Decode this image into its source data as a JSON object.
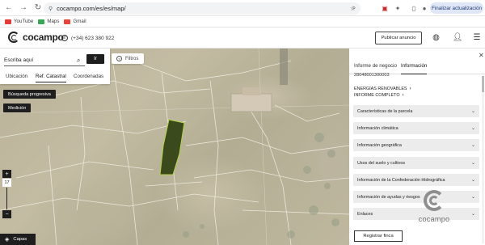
{
  "browser": {
    "url": "cocampo.com/es/es/map/",
    "update_label": "Finalizar actualización",
    "bookmarks": [
      {
        "label": "YouTube",
        "color": "#e53935"
      },
      {
        "label": "Maps",
        "color": "#34a853"
      },
      {
        "label": "Gmail",
        "color": "#ea4335"
      }
    ]
  },
  "header": {
    "logo_text": "cocampo",
    "phone": "(+34) 623 380 922",
    "publish_label": "Publicar anuncio"
  },
  "search": {
    "placeholder": "Escriba aquí",
    "go_label": "Ir",
    "tabs": [
      "Ubicación",
      "Ref. Catastral",
      "Coordenadas"
    ],
    "active_tab": "Ref. Catastral"
  },
  "map": {
    "filters_label": "Filtros",
    "progressive_search_label": "Búsqueda progresiva",
    "measure_label": "Medición",
    "zoom_in": "+",
    "zoom_level": "17",
    "zoom_out": "−",
    "layers_label": "Capas"
  },
  "panel": {
    "tabs": [
      "Informe de negocio",
      "Información"
    ],
    "active_tab": "Información",
    "ref_id": "28048001300003",
    "links": [
      "ENERGÍAS RENOVABLES",
      "INFORME COMPLETO"
    ],
    "sections": [
      "Características de la parcela",
      "Información climática",
      "Información geográfica",
      "Usos del suelo y cultivos",
      "Información de la Confederación Hidrográfica",
      "Información de ayudas y riesgos",
      "Enlaces"
    ],
    "register_label": "Registrar finca"
  },
  "watermark": {
    "text": "cocampo"
  }
}
